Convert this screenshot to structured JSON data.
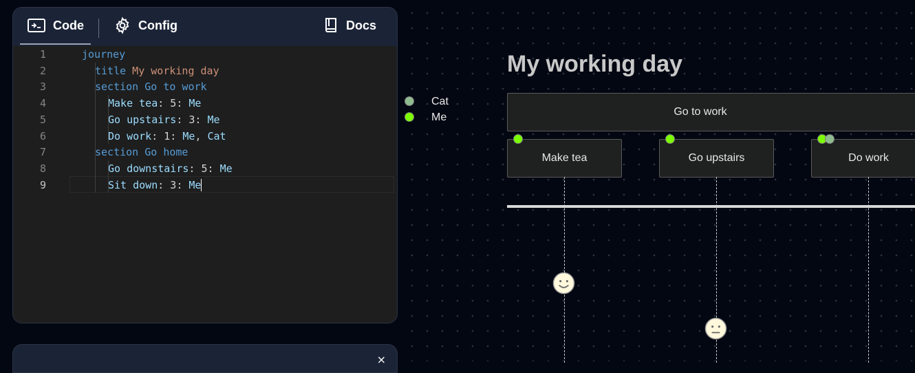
{
  "editor": {
    "tabs": {
      "code": "Code",
      "config": "Config",
      "docs": "Docs"
    },
    "line_numbers": [
      "1",
      "2",
      "3",
      "4",
      "5",
      "6",
      "7",
      "8",
      "9"
    ],
    "lines": [
      [
        {
          "t": "journey",
          "c": "kw"
        }
      ],
      [
        {
          "t": "title",
          "c": "kw"
        },
        {
          "t": " My working day",
          "c": "str"
        }
      ],
      [
        {
          "t": "section Go to work",
          "c": "kw"
        }
      ],
      [
        {
          "t": "Make tea",
          "c": "plain"
        },
        {
          "t": ": 5: ",
          "c": "punct"
        },
        {
          "t": "Me",
          "c": "plain"
        }
      ],
      [
        {
          "t": "Go upstairs",
          "c": "plain"
        },
        {
          "t": ": 3: ",
          "c": "punct"
        },
        {
          "t": "Me",
          "c": "plain"
        }
      ],
      [
        {
          "t": "Do work",
          "c": "plain"
        },
        {
          "t": ": 1: ",
          "c": "punct"
        },
        {
          "t": "Me",
          "c": "plain"
        },
        {
          "t": ", ",
          "c": "punct"
        },
        {
          "t": "Cat",
          "c": "plain"
        }
      ],
      [
        {
          "t": "section Go home",
          "c": "kw"
        }
      ],
      [
        {
          "t": "Go downstairs",
          "c": "plain"
        },
        {
          "t": ": 5: ",
          "c": "punct"
        },
        {
          "t": "Me",
          "c": "plain"
        }
      ],
      [
        {
          "t": "Sit down",
          "c": "plain"
        },
        {
          "t": ": 3: ",
          "c": "punct"
        },
        {
          "t": "Me",
          "c": "plain"
        }
      ]
    ]
  },
  "bottom_panel": {
    "title": "",
    "close": "×"
  },
  "diagram": {
    "title": "My working day",
    "legend": [
      {
        "name": "Cat",
        "color": "#8fbc8f"
      },
      {
        "name": "Me",
        "color": "#7cfc00"
      }
    ],
    "section": "Go to work",
    "tasks": [
      {
        "name": "Make tea",
        "score": 5,
        "actors": [
          "Me"
        ]
      },
      {
        "name": "Go upstairs",
        "score": 3,
        "actors": [
          "Me"
        ]
      },
      {
        "name": "Do work",
        "score": 1,
        "actors": [
          "Me",
          "Cat"
        ]
      }
    ]
  }
}
